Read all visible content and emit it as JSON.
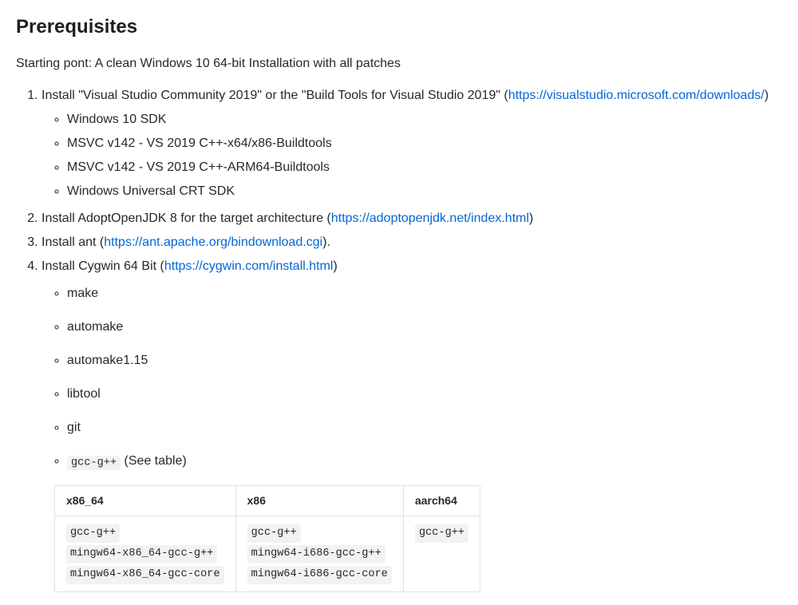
{
  "heading": "Prerequisites",
  "intro": "Starting pont: A clean Windows 10 64-bit Installation with all patches",
  "step1": {
    "pre": "Install \"Visual Studio Community 2019\" or the \"Build Tools for Visual Studio 2019\" (",
    "link_text": "https://visualstudio.microsoft.com/downloads/",
    "post": ")",
    "subs": [
      "Windows 10 SDK",
      "MSVC v142 - VS 2019 C++-x64/x86-Buildtools",
      "MSVC v142 - VS 2019 C++-ARM64-Buildtools",
      "Windows Universal CRT SDK"
    ]
  },
  "step2": {
    "pre": "Install AdoptOpenJDK 8 for the target architecture (",
    "link_text": "https://adoptopenjdk.net/index.html",
    "post": ")"
  },
  "step3": {
    "pre": "Install ant (",
    "link_text": "https://ant.apache.org/bindownload.cgi",
    "post": ")."
  },
  "step4": {
    "pre": "Install Cygwin 64 Bit (",
    "link_text": "https://cygwin.com/install.html",
    "post": ")",
    "subs": [
      "make",
      "automake",
      "automake1.15",
      "libtool",
      "git"
    ],
    "last_sub": {
      "code": "gcc-g++",
      "tail": " (See table)"
    }
  },
  "table": {
    "headers": [
      "x86_64",
      "x86",
      "aarch64"
    ],
    "cells": {
      "c0": [
        "gcc-g++",
        "mingw64-x86_64-gcc-g++",
        "mingw64-x86_64-gcc-core"
      ],
      "c1": [
        "gcc-g++",
        "mingw64-i686-gcc-g++",
        "mingw64-i686-gcc-core"
      ],
      "c2": [
        "gcc-g++"
      ]
    }
  }
}
